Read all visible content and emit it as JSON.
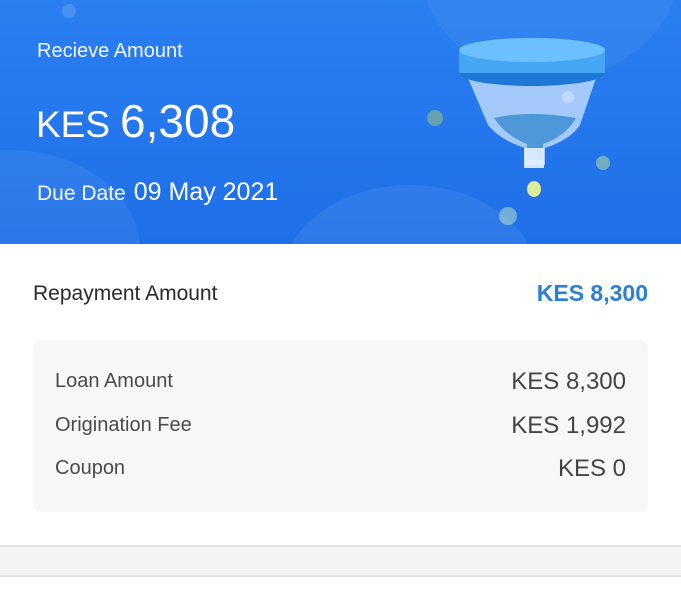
{
  "header": {
    "receive_label": "Recieve Amount",
    "currency": "KES",
    "amount": "6,308",
    "due_label": "Due Date",
    "due_date": "09 May 2021",
    "illustration_icon": "funnel-icon",
    "background_color": "#1f6fe8"
  },
  "repayment": {
    "label": "Repayment Amount",
    "value": "KES 8,300",
    "value_color": "#2a7fd6"
  },
  "details": {
    "rows": [
      {
        "label": "Loan Amount",
        "value": "KES 8,300"
      },
      {
        "label": "Origination Fee",
        "value": "KES 1,992"
      },
      {
        "label": "Coupon",
        "value": "KES 0"
      }
    ]
  }
}
